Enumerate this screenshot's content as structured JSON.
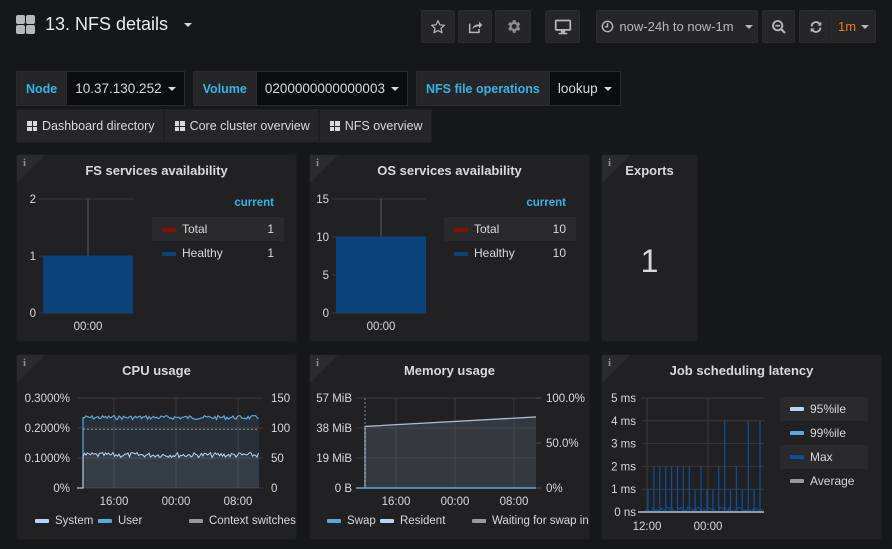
{
  "header": {
    "title": "13. NFS details",
    "icons": {
      "dashboard": "grid-icon",
      "star": "star-icon",
      "share": "share-icon",
      "settings": "gear-icon",
      "tv": "monitor-icon",
      "clock": "clock-icon",
      "zoom_out": "zoom-out-icon",
      "refresh": "refresh-icon"
    },
    "time_range": "now-24h to now-1m",
    "refresh_interval": "1m"
  },
  "variables": [
    {
      "label": "Node",
      "value": "10.37.130.252"
    },
    {
      "label": "Volume",
      "value": "0200000000000003"
    },
    {
      "label": "NFS file operations",
      "value": "lookup"
    }
  ],
  "links": [
    {
      "label": "Dashboard directory"
    },
    {
      "label": "Core cluster overview"
    },
    {
      "label": "NFS overview"
    }
  ],
  "colors": {
    "accent": "#33b5e5",
    "orange": "#eb7b18",
    "total": "#890f02",
    "healthy": "#0a437c",
    "system": "#bad4f5",
    "user": "#5aa9dc",
    "context": "#999999",
    "max": "#0a50a1"
  },
  "panels": {
    "fs": {
      "title": "FS services availability",
      "legend_header": "current"
    },
    "os": {
      "title": "OS services availability",
      "legend_header": "current"
    },
    "exports": {
      "title": "Exports",
      "value": "1"
    },
    "cpu": {
      "title": "CPU usage"
    },
    "mem": {
      "title": "Memory usage"
    },
    "job": {
      "title": "Job scheduling latency"
    }
  },
  "chart_data": [
    {
      "id": "fs",
      "type": "bar",
      "title": "FS services availability",
      "categories": [
        "00:00"
      ],
      "series": [
        {
          "name": "Total",
          "values": [
            1
          ],
          "current": "1"
        },
        {
          "name": "Healthy",
          "values": [
            1
          ],
          "current": "1"
        }
      ],
      "yticks": [
        "0",
        "1",
        "2"
      ],
      "ylim": [
        0,
        2
      ],
      "legend": "right"
    },
    {
      "id": "os",
      "type": "bar",
      "title": "OS services availability",
      "categories": [
        "00:00"
      ],
      "series": [
        {
          "name": "Total",
          "values": [
            10
          ],
          "current": "10"
        },
        {
          "name": "Healthy",
          "values": [
            10
          ],
          "current": "10"
        }
      ],
      "yticks": [
        "0",
        "5",
        "10",
        "15"
      ],
      "ylim": [
        0,
        15
      ],
      "legend": "right"
    },
    {
      "id": "cpu",
      "type": "line",
      "title": "CPU usage",
      "xticks": [
        "16:00",
        "00:00",
        "08:00"
      ],
      "yticks_left": [
        "0%",
        "0.1000%",
        "0.2000%",
        "0.3000%"
      ],
      "ylim_left": [
        0,
        0.3
      ],
      "yticks_right": [
        "0",
        "50",
        "100",
        "150"
      ],
      "ylim_right": [
        0,
        150
      ],
      "series": [
        {
          "name": "System",
          "axis": "left",
          "approx_value": 0.11
        },
        {
          "name": "User",
          "axis": "left",
          "approx_value": 0.235
        },
        {
          "name": "Context switches",
          "axis": "right",
          "approx_value": 98
        }
      ],
      "legend": "bottom"
    },
    {
      "id": "mem",
      "type": "area",
      "title": "Memory usage",
      "xticks": [
        "16:00",
        "00:00",
        "08:00"
      ],
      "yticks_left": [
        "0 B",
        "19 MiB",
        "38 MiB",
        "57 MiB"
      ],
      "ylim_left_mib": [
        0,
        57
      ],
      "yticks_right": [
        "0%",
        "50.0%",
        "100.0%"
      ],
      "ylim_right": [
        0,
        100
      ],
      "series": [
        {
          "name": "Swap",
          "start": 0,
          "end": 0
        },
        {
          "name": "Resident",
          "start_mib": 39,
          "end_mib": 45
        },
        {
          "name": "Waiting for swap in",
          "start": 0,
          "end": 0
        }
      ],
      "legend": "bottom"
    },
    {
      "id": "job",
      "type": "bar",
      "title": "Job scheduling latency",
      "xticks": [
        "12:00",
        "00:00"
      ],
      "yticks": [
        "0 ns",
        "1 ms",
        "2 ms",
        "3 ms",
        "4 ms",
        "5 ms"
      ],
      "ylim_ms": [
        0,
        5
      ],
      "series": [
        {
          "name": "95%ile"
        },
        {
          "name": "99%ile"
        },
        {
          "name": "Max",
          "spikes_ms": [
            1,
            2,
            2,
            2,
            2,
            2,
            2,
            2,
            1,
            2,
            1,
            1,
            2,
            4,
            1,
            2,
            1,
            4,
            1,
            4
          ]
        },
        {
          "name": "Average"
        }
      ],
      "legend": "right"
    }
  ]
}
